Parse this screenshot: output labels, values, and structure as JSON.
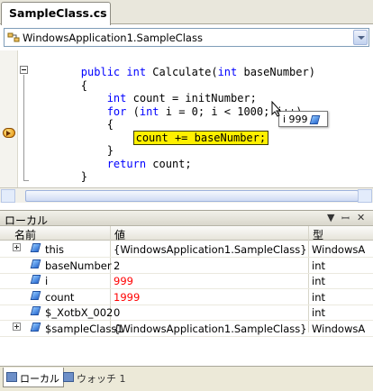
{
  "editor_tab": {
    "title": "SampleClass.cs"
  },
  "class_combo": {
    "value": "WindowsApplication1.SampleClass"
  },
  "code": {
    "lines": [
      {
        "indent": "        ",
        "parts": [
          {
            "t": "public",
            "kw": true
          },
          {
            "t": " "
          },
          {
            "t": "int",
            "kw": true
          },
          {
            "t": " Calculate("
          },
          {
            "t": "int",
            "kw": true
          },
          {
            "t": " baseNumber)"
          }
        ]
      },
      {
        "indent": "        ",
        "parts": [
          {
            "t": "{"
          }
        ]
      },
      {
        "indent": "            ",
        "parts": [
          {
            "t": "int",
            "kw": true
          },
          {
            "t": " count = initNumber;"
          }
        ]
      },
      {
        "indent": "            ",
        "parts": [
          {
            "t": "for",
            "kw": true
          },
          {
            "t": " ("
          },
          {
            "t": "int",
            "kw": true
          },
          {
            "t": " i = 0; i < 1000; i++)"
          }
        ]
      },
      {
        "indent": "            ",
        "parts": [
          {
            "t": "{"
          }
        ]
      },
      {
        "indent": "                ",
        "parts": [
          {
            "t": "count += baseNumber;",
            "exec": true
          }
        ]
      },
      {
        "indent": "            ",
        "parts": [
          {
            "t": "}"
          }
        ]
      },
      {
        "indent": "            ",
        "parts": [
          {
            "t": "return",
            "kw": true
          },
          {
            "t": " count;"
          }
        ]
      },
      {
        "indent": "        ",
        "parts": [
          {
            "t": "}"
          }
        ]
      }
    ]
  },
  "tooltip": {
    "text": "i 999"
  },
  "locals_panel": {
    "title": "ローカル",
    "controls": [
      "▼",
      "ꟷ",
      "✕"
    ],
    "columns": {
      "name": "名前",
      "value": "値",
      "type": "型"
    },
    "rows": [
      {
        "name": "this",
        "value": "{WindowsApplication1.SampleClass}",
        "type": "WindowsA",
        "expandable": true,
        "changed": false
      },
      {
        "name": "baseNumber",
        "value": "2",
        "type": "int",
        "expandable": false,
        "changed": false
      },
      {
        "name": "i",
        "value": "999",
        "type": "int",
        "expandable": false,
        "changed": true
      },
      {
        "name": "count",
        "value": "1999",
        "type": "int",
        "expandable": false,
        "changed": true
      },
      {
        "name": "$_XotbX_002",
        "value": "0",
        "type": "int",
        "expandable": false,
        "changed": false
      },
      {
        "name": "$sampleClass1",
        "value": "{WindowsApplication1.SampleClass}",
        "type": "WindowsA",
        "expandable": true,
        "changed": false
      }
    ]
  },
  "bottom_tabs": [
    {
      "label": "ローカル",
      "active": true
    },
    {
      "label": "ウォッチ 1",
      "active": false
    }
  ],
  "colors": {
    "keyword": "#0000ff",
    "exec_highlight": "#fff000",
    "changed_value": "#ff0000"
  }
}
